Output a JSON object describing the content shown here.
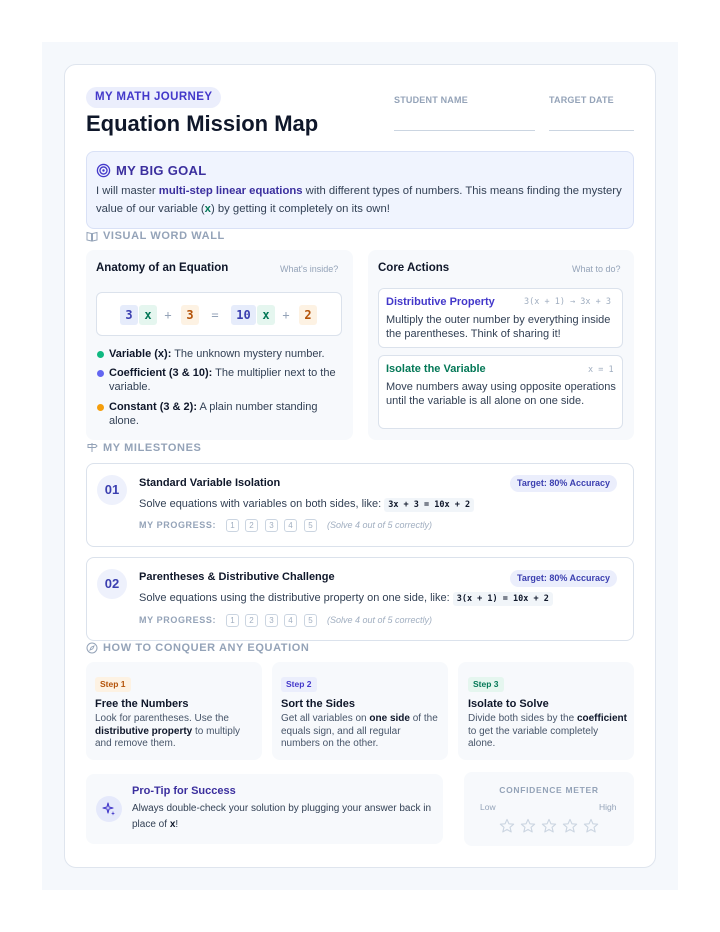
{
  "header": {
    "badge": "MY MATH JOURNEY",
    "title": "Equation Mission Map",
    "student_name_label": "STUDENT NAME",
    "target_date_label": "TARGET DATE"
  },
  "goal": {
    "title": "MY BIG GOAL",
    "text_before": "I will master ",
    "text_bold": "multi-step linear equations",
    "text_middle": " with different types of numbers. This means finding the mystery value of our variable (",
    "variable": "x",
    "text_after": ") by getting it completely on its own!"
  },
  "word_wall": {
    "label": "VISUAL WORD WALL",
    "anatomy": {
      "title": "Anatomy of an Equation",
      "hint": "What's inside?",
      "tokens": [
        "3",
        "x",
        "+",
        "3",
        "=",
        "10",
        "x",
        "+",
        "2"
      ],
      "legend": [
        {
          "term": "Variable (x):",
          "desc": " The unknown mystery number.",
          "color": "#10b981"
        },
        {
          "term": "Coefficient (3 & 10):",
          "desc": " The multiplier next to the variable.",
          "color": "#6366f1"
        },
        {
          "term": "Constant (3 & 2):",
          "desc": " A plain number standing alone.",
          "color": "#f59e0b"
        }
      ]
    },
    "core_actions": {
      "title": "Core Actions",
      "hint": "What to do?",
      "items": [
        {
          "title": "Distributive Property",
          "code": "3(x + 1) → 3x + 3",
          "text": "Multiply the outer number by everything inside the parentheses. Think of sharing it!",
          "color": "#4338ca"
        },
        {
          "title": "Isolate the Variable",
          "code": "x = 1",
          "text": "Move numbers away using opposite operations until the variable is all alone on one side.",
          "color": "#047857"
        }
      ]
    }
  },
  "milestones": {
    "label": "MY MILESTONES",
    "items": [
      {
        "num": "01",
        "title": "Standard Variable Isolation",
        "target": "Target: 80% Accuracy",
        "text": "Solve equations with variables on both sides, like:",
        "example": "3x + 3 = 10x + 2",
        "progress_label": "MY PROGRESS:",
        "boxes": [
          "1",
          "2",
          "3",
          "4",
          "5"
        ],
        "note": "(Solve 4 out of 5 correctly)"
      },
      {
        "num": "02",
        "title": "Parentheses & Distributive Challenge",
        "target": "Target: 80% Accuracy",
        "text": "Solve equations using the distributive property on one side, like:",
        "example": "3(x + 1) = 10x + 2",
        "progress_label": "MY PROGRESS:",
        "boxes": [
          "1",
          "2",
          "3",
          "4",
          "5"
        ],
        "note": "(Solve 4 out of 5 correctly)"
      }
    ]
  },
  "conquer": {
    "label": "HOW TO CONQUER ANY EQUATION",
    "steps": [
      {
        "badge": "Step 1",
        "title": "Free the Numbers",
        "t1": "Look for parentheses. Use the ",
        "b1": "distributive property",
        "t2": " to multiply and remove them.",
        "color": "#b45309",
        "bg": "#fdf2e3"
      },
      {
        "badge": "Step 2",
        "title": "Sort the Sides",
        "t1": "Get all variables on ",
        "b1": "one side",
        "t2": " of the equals sign, and all regular numbers on the other.",
        "color": "#4338ca",
        "bg": "#ebeefc"
      },
      {
        "badge": "Step 3",
        "title": "Isolate to Solve",
        "t1": "Divide both sides by the ",
        "b1": "coefficient",
        "t2": " to get the variable completely alone.",
        "color": "#047857",
        "bg": "#e5f6ef"
      }
    ]
  },
  "tip": {
    "title": "Pro-Tip for Success",
    "text_before": "Always double-check your solution by plugging your answer back in place of ",
    "variable": "x",
    "text_after": "!"
  },
  "meter": {
    "title": "CONFIDENCE METER",
    "low": "Low",
    "high": "High",
    "stars_total": 5,
    "stars_filled": 0
  }
}
